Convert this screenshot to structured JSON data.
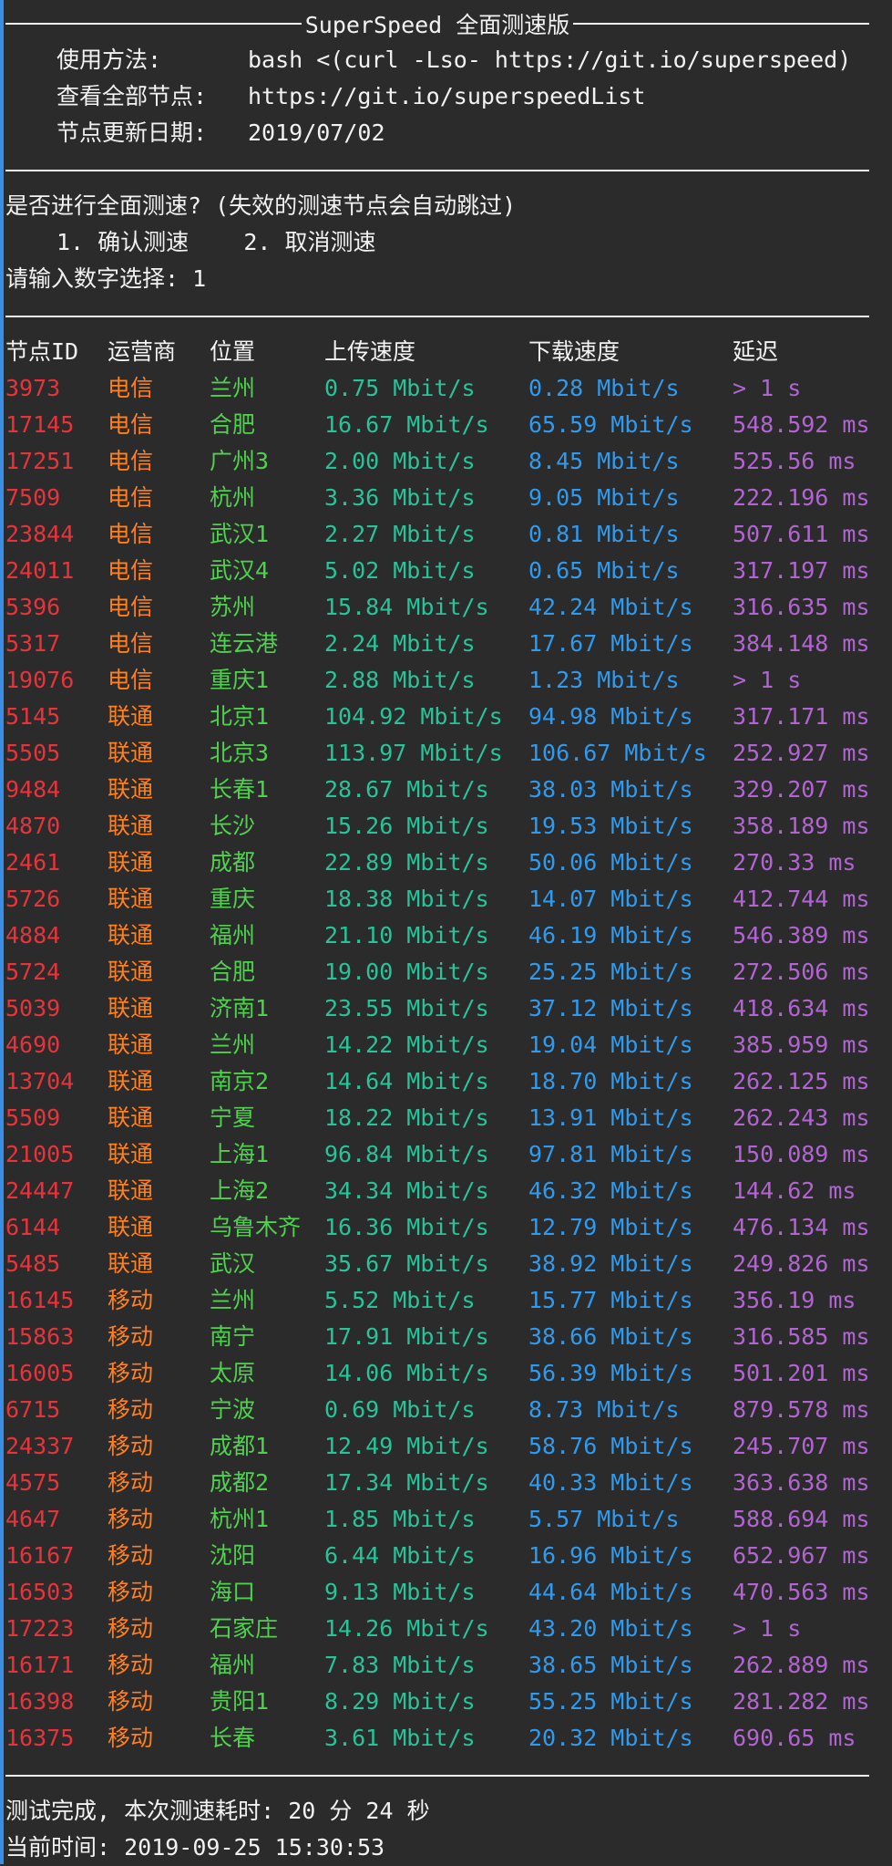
{
  "header": {
    "title": "SuperSpeed 全面测速版"
  },
  "info": [
    {
      "label": "使用方法:",
      "value": "bash <(curl -Lso- https://git.io/superspeed)"
    },
    {
      "label": "查看全部节点:",
      "value": "https://git.io/superspeedList"
    },
    {
      "label": "节点更新日期:",
      "value": "2019/07/02"
    }
  ],
  "prompt": {
    "question": "是否进行全面测速? (失效的测速节点会自动跳过)",
    "options": "1. 确认测速    2. 取消测速",
    "input_line": "请输入数字选择: 1"
  },
  "table": {
    "headers": [
      "节点ID",
      "运营商",
      "位置",
      "上传速度",
      "下载速度",
      "延迟"
    ],
    "rows": [
      [
        "3973",
        "电信",
        "兰州",
        "0.75 Mbit/s",
        "0.28 Mbit/s",
        "> 1 s"
      ],
      [
        "17145",
        "电信",
        "合肥",
        "16.67 Mbit/s",
        "65.59 Mbit/s",
        "548.592 ms"
      ],
      [
        "17251",
        "电信",
        "广州3",
        "2.00 Mbit/s",
        "8.45 Mbit/s",
        "525.56 ms"
      ],
      [
        "7509",
        "电信",
        "杭州",
        "3.36 Mbit/s",
        "9.05 Mbit/s",
        "222.196 ms"
      ],
      [
        "23844",
        "电信",
        "武汉1",
        "2.27 Mbit/s",
        "0.81 Mbit/s",
        "507.611 ms"
      ],
      [
        "24011",
        "电信",
        "武汉4",
        "5.02 Mbit/s",
        "0.65 Mbit/s",
        "317.197 ms"
      ],
      [
        "5396",
        "电信",
        "苏州",
        "15.84 Mbit/s",
        "42.24 Mbit/s",
        "316.635 ms"
      ],
      [
        "5317",
        "电信",
        "连云港",
        "2.24 Mbit/s",
        "17.67 Mbit/s",
        "384.148 ms"
      ],
      [
        "19076",
        "电信",
        "重庆1",
        "2.88 Mbit/s",
        "1.23 Mbit/s",
        "> 1 s"
      ],
      [
        "5145",
        "联通",
        "北京1",
        "104.92 Mbit/s",
        "94.98 Mbit/s",
        "317.171 ms"
      ],
      [
        "5505",
        "联通",
        "北京3",
        "113.97 Mbit/s",
        "106.67 Mbit/s",
        "252.927 ms"
      ],
      [
        "9484",
        "联通",
        "长春1",
        "28.67 Mbit/s",
        "38.03 Mbit/s",
        "329.207 ms"
      ],
      [
        "4870",
        "联通",
        "长沙",
        "15.26 Mbit/s",
        "19.53 Mbit/s",
        "358.189 ms"
      ],
      [
        "2461",
        "联通",
        "成都",
        "22.89 Mbit/s",
        "50.06 Mbit/s",
        "270.33 ms"
      ],
      [
        "5726",
        "联通",
        "重庆",
        "18.38 Mbit/s",
        "14.07 Mbit/s",
        "412.744 ms"
      ],
      [
        "4884",
        "联通",
        "福州",
        "21.10 Mbit/s",
        "46.19 Mbit/s",
        "546.389 ms"
      ],
      [
        "5724",
        "联通",
        "合肥",
        "19.00 Mbit/s",
        "25.25 Mbit/s",
        "272.506 ms"
      ],
      [
        "5039",
        "联通",
        "济南1",
        "23.55 Mbit/s",
        "37.12 Mbit/s",
        "418.634 ms"
      ],
      [
        "4690",
        "联通",
        "兰州",
        "14.22 Mbit/s",
        "19.04 Mbit/s",
        "385.959 ms"
      ],
      [
        "13704",
        "联通",
        "南京2",
        "14.64 Mbit/s",
        "18.70 Mbit/s",
        "262.125 ms"
      ],
      [
        "5509",
        "联通",
        "宁夏",
        "18.22 Mbit/s",
        "13.91 Mbit/s",
        "262.243 ms"
      ],
      [
        "21005",
        "联通",
        "上海1",
        "96.84 Mbit/s",
        "97.81 Mbit/s",
        "150.089 ms"
      ],
      [
        "24447",
        "联通",
        "上海2",
        "34.34 Mbit/s",
        "46.32 Mbit/s",
        "144.62 ms"
      ],
      [
        "6144",
        "联通",
        "乌鲁木齐",
        "16.36 Mbit/s",
        "12.79 Mbit/s",
        "476.134 ms"
      ],
      [
        "5485",
        "联通",
        "武汉",
        "35.67 Mbit/s",
        "38.92 Mbit/s",
        "249.826 ms"
      ],
      [
        "16145",
        "移动",
        "兰州",
        "5.52 Mbit/s",
        "15.77 Mbit/s",
        "356.19 ms"
      ],
      [
        "15863",
        "移动",
        "南宁",
        "17.91 Mbit/s",
        "38.66 Mbit/s",
        "316.585 ms"
      ],
      [
        "16005",
        "移动",
        "太原",
        "14.06 Mbit/s",
        "56.39 Mbit/s",
        "501.201 ms"
      ],
      [
        "6715",
        "移动",
        "宁波",
        "0.69 Mbit/s",
        "8.73 Mbit/s",
        "879.578 ms"
      ],
      [
        "24337",
        "移动",
        "成都1",
        "12.49 Mbit/s",
        "58.76 Mbit/s",
        "245.707 ms"
      ],
      [
        "4575",
        "移动",
        "成都2",
        "17.34 Mbit/s",
        "40.33 Mbit/s",
        "363.638 ms"
      ],
      [
        "4647",
        "移动",
        "杭州1",
        "1.85 Mbit/s",
        "5.57 Mbit/s",
        "588.694 ms"
      ],
      [
        "16167",
        "移动",
        "沈阳",
        "6.44 Mbit/s",
        "16.96 Mbit/s",
        "652.967 ms"
      ],
      [
        "16503",
        "移动",
        "海口",
        "9.13 Mbit/s",
        "44.64 Mbit/s",
        "470.563 ms"
      ],
      [
        "17223",
        "移动",
        "石家庄",
        "14.26 Mbit/s",
        "43.20 Mbit/s",
        "> 1 s"
      ],
      [
        "16171",
        "移动",
        "福州",
        "7.83 Mbit/s",
        "38.65 Mbit/s",
        "262.889 ms"
      ],
      [
        "16398",
        "移动",
        "贵阳1",
        "8.29 Mbit/s",
        "55.25 Mbit/s",
        "281.282 ms"
      ],
      [
        "16375",
        "移动",
        "长春",
        "3.61 Mbit/s",
        "20.32 Mbit/s",
        "690.65 ms"
      ]
    ]
  },
  "footer": {
    "complete": "测试完成, 本次测速耗时: 20 分 24 秒",
    "current_time": "当前时间: 2019-09-25 15:30:53"
  },
  "colors": {
    "background": "#2b2b2b",
    "node_id": "#e8333a",
    "isp": "#ff7f1f",
    "location": "#4fd14f",
    "upload": "#27c49a",
    "download": "#2f9bf0",
    "latency": "#b265d2"
  }
}
